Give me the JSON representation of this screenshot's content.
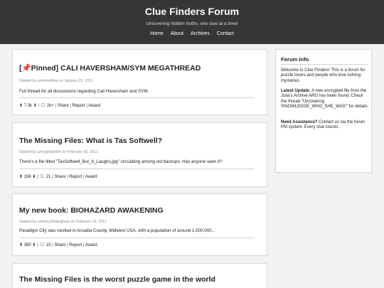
{
  "header": {
    "title": "Clue Finders Forum",
    "tagline": "Uncovering hidden truths, one clue at a time!",
    "nav": [
      "Home",
      "About",
      "Archives",
      "Contact"
    ]
  },
  "posts": [
    {
      "title": "[📌Pinned] CALI HAVERSHAM/SYM MEGATHREAD",
      "meta": "Started by u/mirrorMira on January 22, 2011",
      "excerpt": "Full thread for all discussions regarding Cali Haversham and SYM.",
      "votes": "7.3k",
      "comments": "2k+",
      "share": "Share",
      "report": "Report",
      "award": "Award"
    },
    {
      "title": "The Missing Files: What is Tas Softwell?",
      "meta": "Started by u/crypt0sp00n on February 25, 2011",
      "excerpt": "There's a file titled \"TasSoftwell_But_It_Laughs.jpg\" circulating among old backups. Has anyone seen it?",
      "votes": "156",
      "comments": "21",
      "share": "Share",
      "report": "Report",
      "award": "Award"
    },
    {
      "title": "My new book: BIOHAZARD AWAKENING",
      "meta": "Started by u/mercyfortanghulu on February 14, 2011",
      "excerpt": "Paradigm City was nestled in Arcadia County, Midwest USA, with a population of around 1,500,000...",
      "votes": "360",
      "comments": "15",
      "share": "Share",
      "report": "Report",
      "award": "Award"
    },
    {
      "title": "The Missing Files is the worst puzzle game in the world"
    }
  ],
  "sidebar": {
    "title": "Forum Info",
    "welcome": "Welcome to Clue Finders! This is a forum for puzzle lovers and people who love solving mysteries.",
    "update_label": "Latest Update:",
    "update_text": "A new encrypted file from the Julia's Archive ARG has been found. Check the thread \"Uncovering 'KNOWLEDGE_WHO_SHE_WAS'\" for details.",
    "assist_label": "Need Assistance?",
    "assist_text": "Contact us via the forum PM system. Every clue counts."
  },
  "icons": {
    "upvote": "arrow-up-icon",
    "downvote": "arrow-down-icon",
    "comments": "speech-bubble-icon"
  }
}
